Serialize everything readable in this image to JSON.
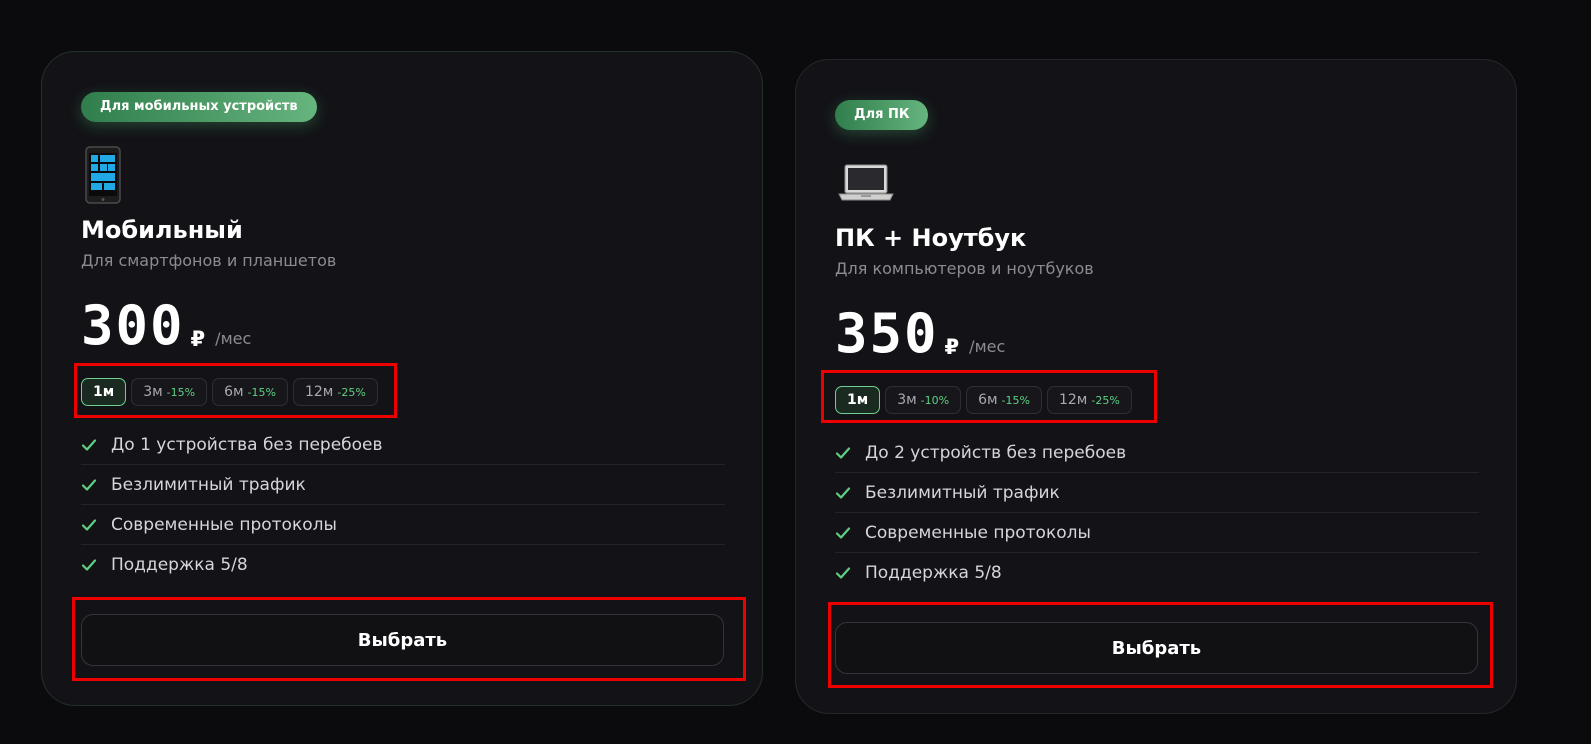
{
  "plans": [
    {
      "badge": "Для мобильных устройств",
      "icon": "mobile-phone-icon",
      "title": "Мобильный",
      "subtitle": "Для смартфонов и планшетов",
      "price": "300",
      "currency": "₽",
      "period": "/мес",
      "periods": [
        {
          "label": "1м",
          "discount": ""
        },
        {
          "label": "3м",
          "discount": "-15%"
        },
        {
          "label": "6м",
          "discount": "-15%"
        },
        {
          "label": "12м",
          "discount": "-25%"
        }
      ],
      "active_period": "1м",
      "features": [
        "До 1 устройства без перебоев",
        "Безлимитный трафик",
        "Современные протоколы",
        "Поддержка 5/8"
      ],
      "button": "Выбрать"
    },
    {
      "badge": "Для ПК",
      "icon": "laptop-icon",
      "title": "ПК + Ноутбук",
      "subtitle": "Для компьютеров и ноутбуков",
      "price": "350",
      "currency": "₽",
      "period": "/мес",
      "periods": [
        {
          "label": "1м",
          "discount": ""
        },
        {
          "label": "3м",
          "discount": "-10%"
        },
        {
          "label": "6м",
          "discount": "-15%"
        },
        {
          "label": "12м",
          "discount": "-25%"
        }
      ],
      "active_period": "1м",
      "features": [
        "До 2 устройств без перебоев",
        "Безлимитный трафик",
        "Современные протоколы",
        "Поддержка 5/8"
      ],
      "button": "Выбрать"
    }
  ],
  "colors": {
    "background": "#0b0b0e",
    "card": "#131317",
    "accent": "#5fd082",
    "highlight": "#ee0000"
  }
}
